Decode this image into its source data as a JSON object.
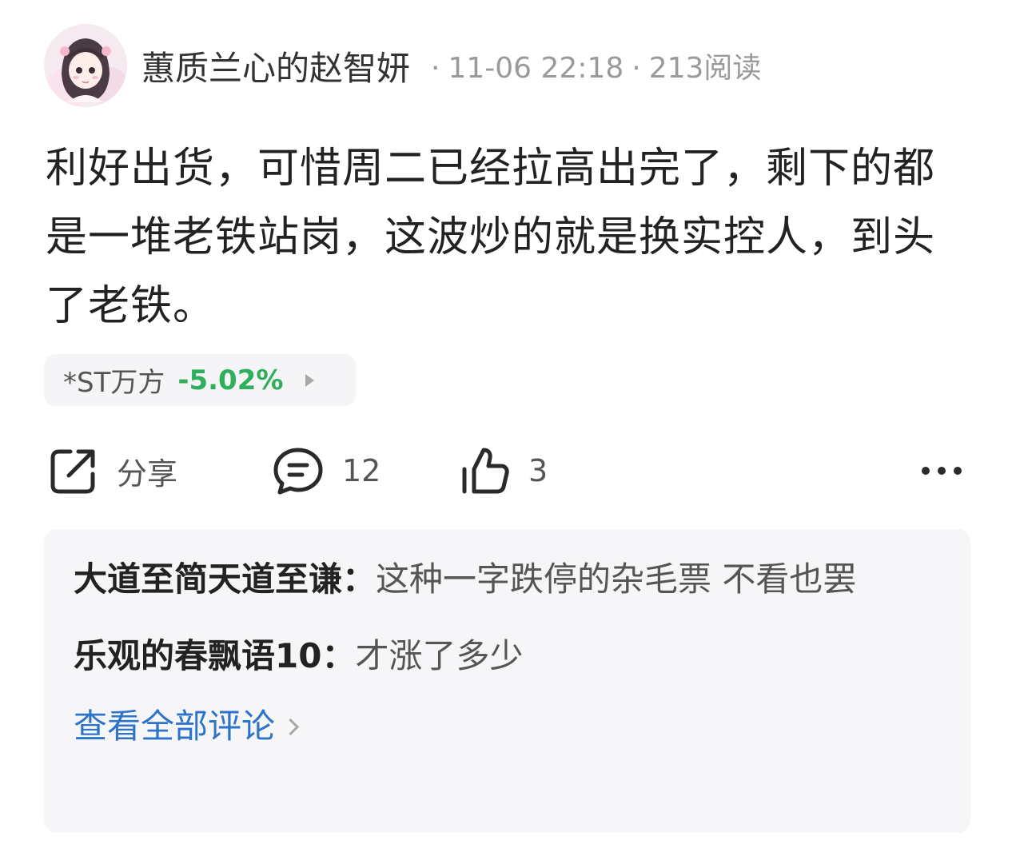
{
  "post": {
    "author": "蕙质兰心的赵智妍",
    "separator": "·",
    "time": "11-06 22:18",
    "reads": "213阅读",
    "text": "利好出货，可惜周二已经拉高出完了，剩下的都是一堆老铁站岗，这波炒的就是换实控人，到头了老铁。"
  },
  "stock": {
    "name": "*ST万方",
    "change": "-5.02%",
    "change_color": "#2fae5b"
  },
  "actions": {
    "share_label": "分享",
    "comment_count": "12",
    "like_count": "3",
    "share_icon": "share-icon",
    "comment_icon": "comment-icon",
    "like_icon": "thumbs-up-icon",
    "more_icon": "more-icon"
  },
  "comments": [
    {
      "name": "大道至简天道至谦：",
      "text": "这种一字跌停的杂毛票 不看也罢"
    },
    {
      "name": "乐观的春飘语10：",
      "text": "才涨了多少"
    }
  ],
  "view_all_label": "查看全部评论",
  "colors": {
    "link": "#2d73c9",
    "gain_down": "#2fae5b",
    "panel_bg": "#f6f6f8"
  }
}
